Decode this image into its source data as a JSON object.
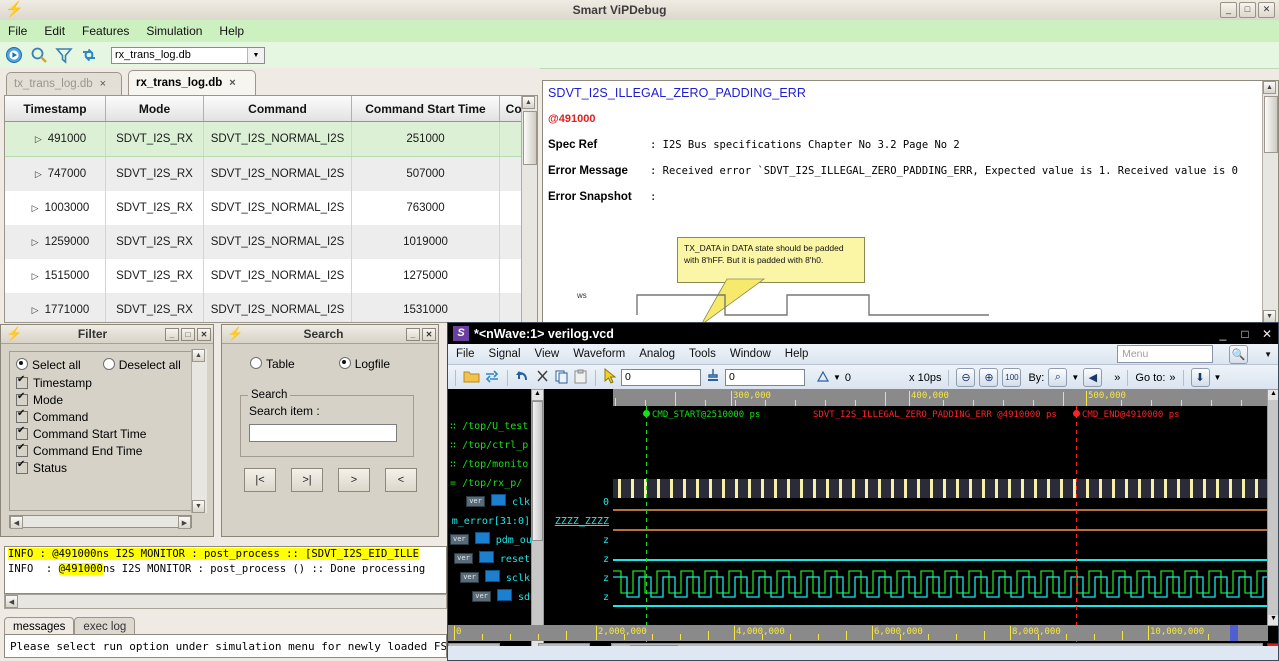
{
  "main_window": {
    "title": "Smart ViPDebug",
    "app_icon": "bolt-icon",
    "window_buttons": [
      "minimize",
      "maximize",
      "close"
    ],
    "menubar": [
      {
        "label": "File",
        "mnemonic": "F"
      },
      {
        "label": "Edit",
        "mnemonic": "E"
      },
      {
        "label": "Features",
        "mnemonic": "t"
      },
      {
        "label": "Simulation",
        "mnemonic": "u"
      },
      {
        "label": "Help",
        "mnemonic": "H"
      }
    ],
    "toolbar": {
      "icons": [
        "run-icon",
        "search-icon",
        "filter-icon",
        "refresh-icon"
      ],
      "db_combo_value": "rx_trans_log.db"
    },
    "tabs": [
      {
        "label": "tx_trans_log.db",
        "close": "×",
        "active": false
      },
      {
        "label": "rx_trans_log.db",
        "close": "×",
        "active": true
      }
    ]
  },
  "table": {
    "columns": [
      "Timestamp",
      "Mode",
      "Command",
      "Command Start Time",
      "Com"
    ],
    "rows": [
      {
        "timestamp": "491000",
        "mode": "SDVT_I2S_RX",
        "command": "SDVT_I2S_NORMAL_I2S",
        "start": "251000",
        "end": "",
        "selected": true
      },
      {
        "timestamp": "747000",
        "mode": "SDVT_I2S_RX",
        "command": "SDVT_I2S_NORMAL_I2S",
        "start": "507000",
        "end": "",
        "selected": false
      },
      {
        "timestamp": "1003000",
        "mode": "SDVT_I2S_RX",
        "command": "SDVT_I2S_NORMAL_I2S",
        "start": "763000",
        "end": "",
        "selected": false
      },
      {
        "timestamp": "1259000",
        "mode": "SDVT_I2S_RX",
        "command": "SDVT_I2S_NORMAL_I2S",
        "start": "1019000",
        "end": "",
        "selected": false
      },
      {
        "timestamp": "1515000",
        "mode": "SDVT_I2S_RX",
        "command": "SDVT_I2S_NORMAL_I2S",
        "start": "1275000",
        "end": "",
        "selected": false
      },
      {
        "timestamp": "1771000",
        "mode": "SDVT_I2S_RX",
        "command": "SDVT_I2S_NORMAL_I2S",
        "start": "1531000",
        "end": "",
        "selected": false
      }
    ],
    "expander_glyph": "▷"
  },
  "detail": {
    "error_title": "SDVT_I2S_ILLEGAL_ZERO_PADDING_ERR",
    "timestamp": "@491000",
    "fields": [
      {
        "key": "Spec Ref",
        "value": ": I2S Bus specifications Chapter No 3.2 Page No 2"
      },
      {
        "key": "Error Message",
        "value": ": Received error `SDVT_I2S_ILLEGAL_ZERO_PADDING_ERR, Expected value is 1. Received value is 0"
      },
      {
        "key": "Error Snapshot",
        "value": ":"
      }
    ],
    "snapshot": {
      "callout_text": "TX_DATA in DATA state should be padded with 8'hFF. But it is padded with 8'h0.",
      "signal_label": "ws",
      "callout_color": "#fbf5a6"
    }
  },
  "filter_window": {
    "title": "Filter",
    "buttons": [
      "minimize",
      "maximize",
      "close"
    ],
    "select_all": "Select all",
    "deselect_all": "Deselect all",
    "select_all_checked": true,
    "items": [
      {
        "label": "Timestamp",
        "checked": true
      },
      {
        "label": "Mode",
        "checked": true
      },
      {
        "label": "Command",
        "checked": true
      },
      {
        "label": "Command Start Time",
        "checked": true
      },
      {
        "label": "Command End Time",
        "checked": true
      },
      {
        "label": "Status",
        "checked": true
      }
    ]
  },
  "search_window": {
    "title": "Search",
    "buttons": [
      "minimize",
      "close"
    ],
    "mode_table": "Table",
    "mode_logfile": "Logfile",
    "mode_selected": "Logfile",
    "group_legend": "Search",
    "field_label": "Search item :",
    "field_value": "",
    "nav_buttons": [
      "|<",
      ">|",
      ">",
      "<"
    ]
  },
  "log": {
    "lines": [
      {
        "text": "INFO  : @491000ns I2S MONITOR : post_process :: [SDVT_I2S_EID_ILLE",
        "highlight": "full"
      },
      {
        "text": "INFO  : @491000ns I2S MONITOR : post_process () :: Done processing",
        "highlight": "partial",
        "highlight_token": "@491000"
      }
    ],
    "tabs": [
      {
        "label": "messages",
        "active": true
      },
      {
        "label": "exec log",
        "active": false
      }
    ],
    "statusbar": "Please select run option under simulation menu for newly loaded FS"
  },
  "nwave": {
    "title": "*<nWave:1> verilog.vcd",
    "app_icon": "s-icon",
    "window_buttons": [
      "minimize",
      "maximize",
      "close"
    ],
    "menubar": [
      "File",
      "Signal",
      "View",
      "Waveform",
      "Analog",
      "Tools",
      "Window",
      "Help"
    ],
    "menu_search_placeholder": "Menu",
    "toolbar": {
      "icons": [
        "open-folder-icon",
        "reload-icon",
        "undo-icon",
        "cut-icon",
        "copy-icon",
        "paste-icon",
        "pointer-icon"
      ],
      "marker1_value": "0",
      "marker2_value": "0",
      "delta_label": "0",
      "time_unit": "x 10ps",
      "zoom_out_icon": "zoom-out-icon",
      "zoom_in_icon": "zoom-in-icon",
      "zoom_fit_icon": "zoom-100-icon",
      "by_label": "By:",
      "overflow": "»",
      "goto_label": "Go to:",
      "download_icon": "download-icon"
    },
    "signals": [
      {
        "name": "/top/U_test",
        "type": "scope",
        "value": "",
        "kind": "group"
      },
      {
        "name": "/top/ctrl_p",
        "type": "scope",
        "value": "",
        "kind": "group"
      },
      {
        "name": "/top/monito",
        "type": "scope",
        "value": "",
        "kind": "group"
      },
      {
        "name": "/top/rx_p/",
        "type": "scope",
        "value": "",
        "kind": "group"
      },
      {
        "name": "clk",
        "tag": "ver",
        "value": "0",
        "kind": "signal"
      },
      {
        "name": "m_error[31:0]",
        "tag": "",
        "value": "ZZZZ_ZZZZ",
        "kind": "bus"
      },
      {
        "name": "pdm_out",
        "tag": "ver",
        "value": "z",
        "kind": "signal"
      },
      {
        "name": "reset",
        "tag": "ver",
        "value": "z",
        "kind": "signal"
      },
      {
        "name": "sclk",
        "tag": "ver",
        "value": "z",
        "kind": "signal"
      },
      {
        "name": "sd",
        "tag": "ver",
        "value": "z",
        "kind": "signal"
      }
    ],
    "markers": [
      {
        "label": "CMD_START@2510000 ps",
        "color": "#18e018",
        "x_pct": 5.5
      },
      {
        "label": "SDVT_I2S_ILLEGAL_ZERO_PADDING_ERR @4910000 ps",
        "color": "#ff2222",
        "x_pct": 28
      },
      {
        "label": "CMD_END@4910000 ps",
        "color": "#ff2222",
        "x_pct": 71
      }
    ],
    "top_ruler_ticks": [
      {
        "label": "300,000",
        "x_pct": 18
      },
      {
        "label": "400,000",
        "x_pct": 45
      },
      {
        "label": "500,000",
        "x_pct": 72
      }
    ],
    "bottom_ruler_ticks": [
      {
        "label": "0",
        "x_pct": 0.5
      },
      {
        "label": "2,000,000",
        "x_pct": 18
      },
      {
        "label": "4,000,000",
        "x_pct": 34.5
      },
      {
        "label": "6,000,000",
        "x_pct": 51.5
      },
      {
        "label": "8,000,000",
        "x_pct": 68
      },
      {
        "label": "10,000,000",
        "x_pct": 85
      }
    ]
  },
  "colors": {
    "accent_green": "#cdf0c0",
    "selection_green": "#dcf0d5",
    "error_red": "#e02020",
    "link_blue": "#1d1dd1",
    "wave_green": "#18e018",
    "wave_cyan": "#18e8e8",
    "wave_yellow": "#f5e642",
    "callout_yellow": "#fbf5a6",
    "highlight_yellow": "#ffff00"
  }
}
